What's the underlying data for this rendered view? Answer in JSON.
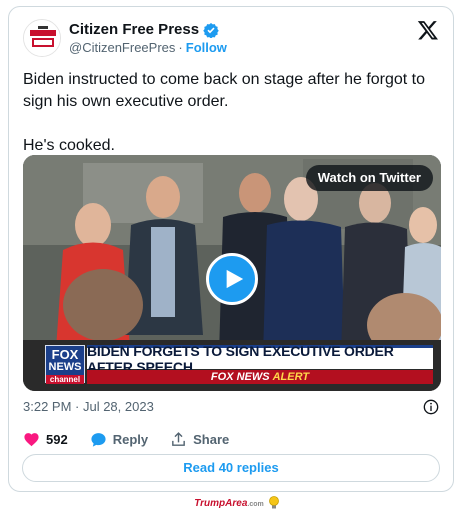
{
  "tweet": {
    "display_name": "Citizen Free Press",
    "handle": "@CitizenFreePres",
    "separator": "·",
    "follow_label": "Follow",
    "text_line1": "Biden instructed to come back on stage after he forgot to sign his own executive order.",
    "text_line2": "He's cooked.",
    "timestamp": "3:22 PM · Jul 28, 2023"
  },
  "media": {
    "watch_label": "Watch on Twitter",
    "chyron": "BIDEN FORGETS TO SIGN EXECUTIVE ORDER AFTER SPEECH",
    "alert_brand": "FOX NEWS",
    "alert_word": "ALERT",
    "logo": {
      "line1": "FOX",
      "line2": "NEWS",
      "line3": "channel"
    }
  },
  "actions": {
    "like_count": "592",
    "reply_label": "Reply",
    "share_label": "Share",
    "read_replies": "Read 40 replies"
  },
  "footer": {
    "site_name": "TrumpArea",
    "site_tld": ".com"
  },
  "colors": {
    "accent": "#1d9bf0",
    "like": "#f91880",
    "fox_blue": "#1b3f8a",
    "fox_red": "#b30f1f"
  },
  "icons": [
    "verified-badge-icon",
    "x-logo-icon",
    "play-icon",
    "info-icon",
    "heart-icon",
    "reply-bubble-icon",
    "share-icon",
    "lightbulb-icon"
  ]
}
